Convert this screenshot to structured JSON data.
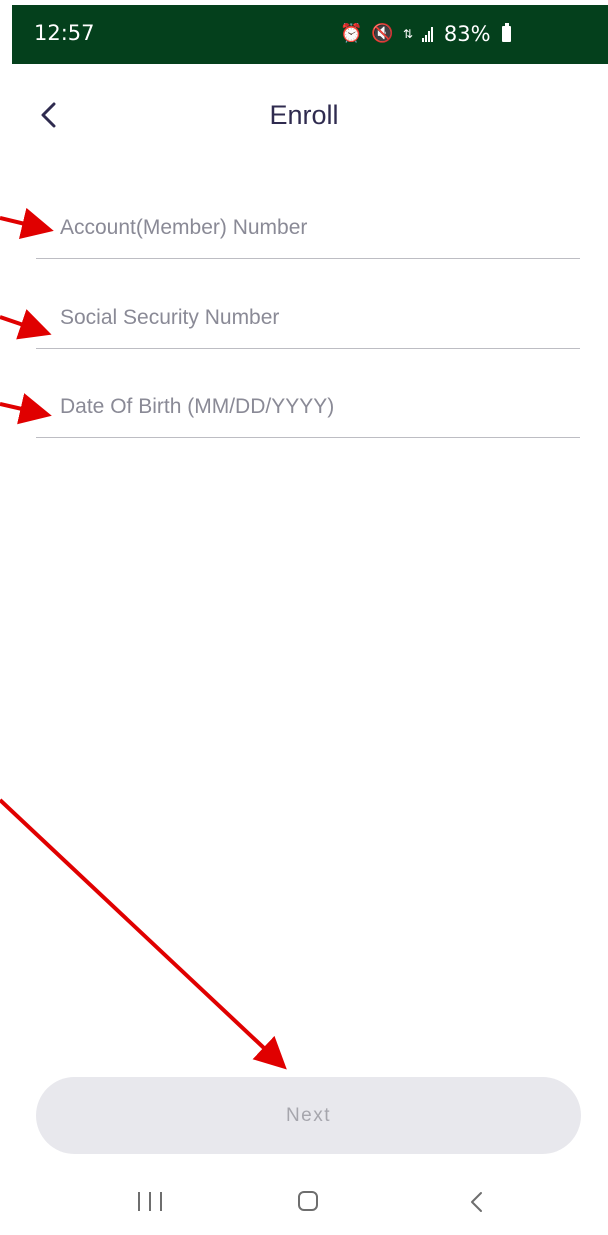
{
  "status_bar": {
    "time": "12:57",
    "battery": "83%",
    "icons": [
      "alarm-icon",
      "mute-icon",
      "data-transfer-icon",
      "signal-icon",
      "battery-icon"
    ]
  },
  "header": {
    "title": "Enroll",
    "back_icon": "chevron-left-icon"
  },
  "form": {
    "account_number": {
      "placeholder": "Account(Member) Number",
      "value": ""
    },
    "ssn": {
      "placeholder": "Social Security Number",
      "value": ""
    },
    "dob": {
      "placeholder": "Date Of Birth (MM/DD/YYYY)",
      "value": ""
    }
  },
  "actions": {
    "next_label": "Next"
  },
  "nav_bar": {
    "icons": [
      "recent-apps-icon",
      "home-icon",
      "back-icon"
    ]
  },
  "colors": {
    "status_bar_bg": "#04401c",
    "title_text": "#2f2b4f",
    "placeholder_text": "#8a8a96",
    "divider": "#bdbdc3",
    "button_bg": "#e8e8ed",
    "button_text": "#a6a6ad",
    "annotation_arrow": "#e00000"
  }
}
